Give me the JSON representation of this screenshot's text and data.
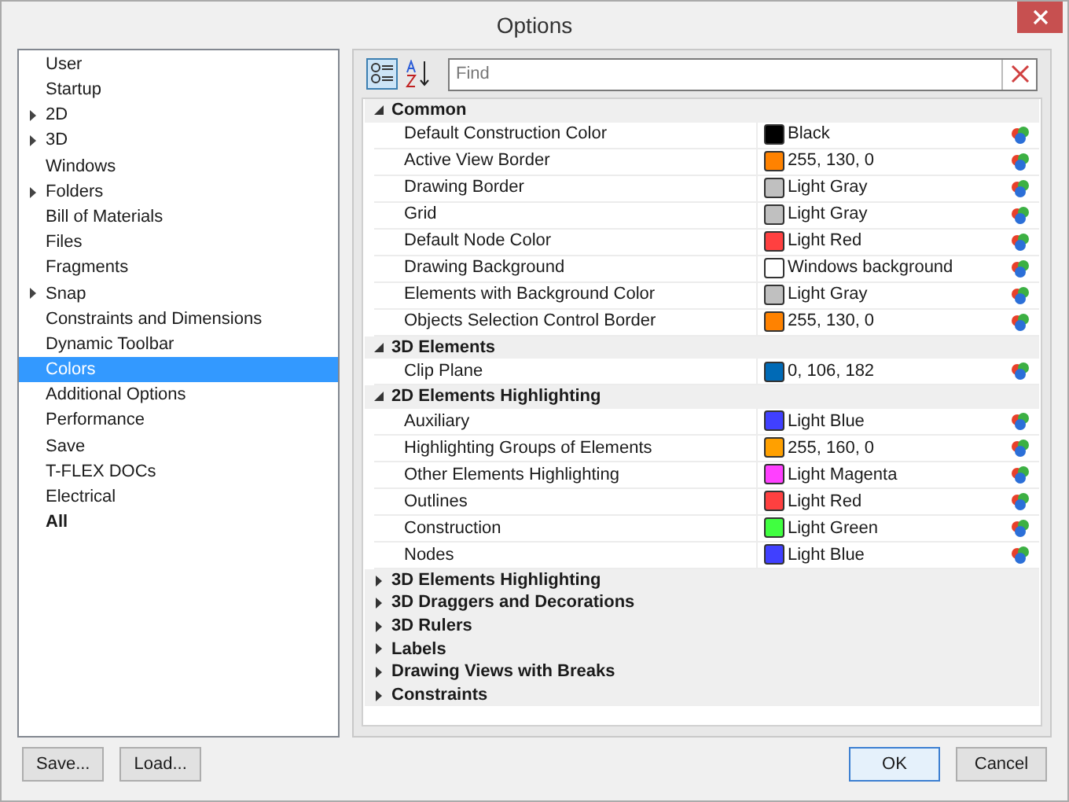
{
  "window": {
    "title": "Options"
  },
  "sidebar": {
    "items": [
      {
        "label": "User",
        "expandable": false,
        "selected": false,
        "bold": false
      },
      {
        "label": "Startup",
        "expandable": false,
        "selected": false,
        "bold": false
      },
      {
        "label": "2D",
        "expandable": true,
        "selected": false,
        "bold": false
      },
      {
        "label": "3D",
        "expandable": true,
        "selected": false,
        "bold": false
      },
      {
        "label": "Windows",
        "expandable": false,
        "selected": false,
        "bold": false
      },
      {
        "label": "Folders",
        "expandable": true,
        "selected": false,
        "bold": false
      },
      {
        "label": "Bill of Materials",
        "expandable": false,
        "selected": false,
        "bold": false
      },
      {
        "label": "Files",
        "expandable": false,
        "selected": false,
        "bold": false
      },
      {
        "label": "Fragments",
        "expandable": false,
        "selected": false,
        "bold": false
      },
      {
        "label": "Snap",
        "expandable": true,
        "selected": false,
        "bold": false
      },
      {
        "label": "Constraints and Dimensions",
        "expandable": false,
        "selected": false,
        "bold": false
      },
      {
        "label": "Dynamic Toolbar",
        "expandable": false,
        "selected": false,
        "bold": false
      },
      {
        "label": "Colors",
        "expandable": false,
        "selected": true,
        "bold": false
      },
      {
        "label": "Additional Options",
        "expandable": false,
        "selected": false,
        "bold": false
      },
      {
        "label": "Performance",
        "expandable": false,
        "selected": false,
        "bold": false
      },
      {
        "label": "Save",
        "expandable": false,
        "selected": false,
        "bold": false
      },
      {
        "label": "T-FLEX DOCs",
        "expandable": false,
        "selected": false,
        "bold": false
      },
      {
        "label": "Electrical",
        "expandable": false,
        "selected": false,
        "bold": false
      },
      {
        "label": "All",
        "expandable": false,
        "selected": false,
        "bold": true
      }
    ]
  },
  "toolbar": {
    "categorized_selected": true,
    "sort_selected": false,
    "search": {
      "placeholder": "Find"
    }
  },
  "sections": [
    {
      "title": "Common",
      "expanded": true,
      "rows": [
        {
          "name": "Default Construction Color",
          "color": "#000000",
          "value": "Black"
        },
        {
          "name": "Active View Border",
          "color": "#ff8200",
          "value": "255, 130, 0"
        },
        {
          "name": "Drawing Border",
          "color": "#c0c0c0",
          "value": "Light Gray"
        },
        {
          "name": "Grid",
          "color": "#c0c0c0",
          "value": "Light Gray"
        },
        {
          "name": "Default Node Color",
          "color": "#ff4040",
          "value": "Light Red"
        },
        {
          "name": "Drawing Background",
          "color": "#ffffff",
          "value": "Windows background"
        },
        {
          "name": "Elements with Background Color",
          "color": "#c0c0c0",
          "value": "Light Gray"
        },
        {
          "name": "Objects Selection Control Border",
          "color": "#ff8200",
          "value": "255, 130, 0"
        }
      ]
    },
    {
      "title": "3D Elements",
      "expanded": true,
      "rows": [
        {
          "name": "Clip Plane",
          "color": "#006ab6",
          "value": "0, 106, 182"
        }
      ]
    },
    {
      "title": "2D Elements Highlighting",
      "expanded": true,
      "rows": [
        {
          "name": "Auxiliary",
          "color": "#4040ff",
          "value": "Light Blue"
        },
        {
          "name": "Highlighting Groups of Elements",
          "color": "#ffa000",
          "value": "255, 160, 0"
        },
        {
          "name": "Other Elements Highlighting",
          "color": "#ff40ff",
          "value": "Light Magenta"
        },
        {
          "name": "Outlines",
          "color": "#ff4040",
          "value": "Light Red"
        },
        {
          "name": "Construction",
          "color": "#40ff40",
          "value": "Light Green"
        },
        {
          "name": "Nodes",
          "color": "#4040ff",
          "value": "Light Blue"
        }
      ]
    },
    {
      "title": "3D Elements Highlighting",
      "expanded": false
    },
    {
      "title": "3D Draggers and Decorations",
      "expanded": false
    },
    {
      "title": "3D Rulers",
      "expanded": false
    },
    {
      "title": "Labels",
      "expanded": false
    },
    {
      "title": "Drawing Views with Breaks",
      "expanded": false
    },
    {
      "title": "Constraints",
      "expanded": false
    }
  ],
  "buttons": [
    {
      "label": "Save...",
      "default": false
    },
    {
      "label": "Load...",
      "default": false
    },
    {
      "label": "OK",
      "default": true
    },
    {
      "label": "Cancel",
      "default": false
    }
  ]
}
